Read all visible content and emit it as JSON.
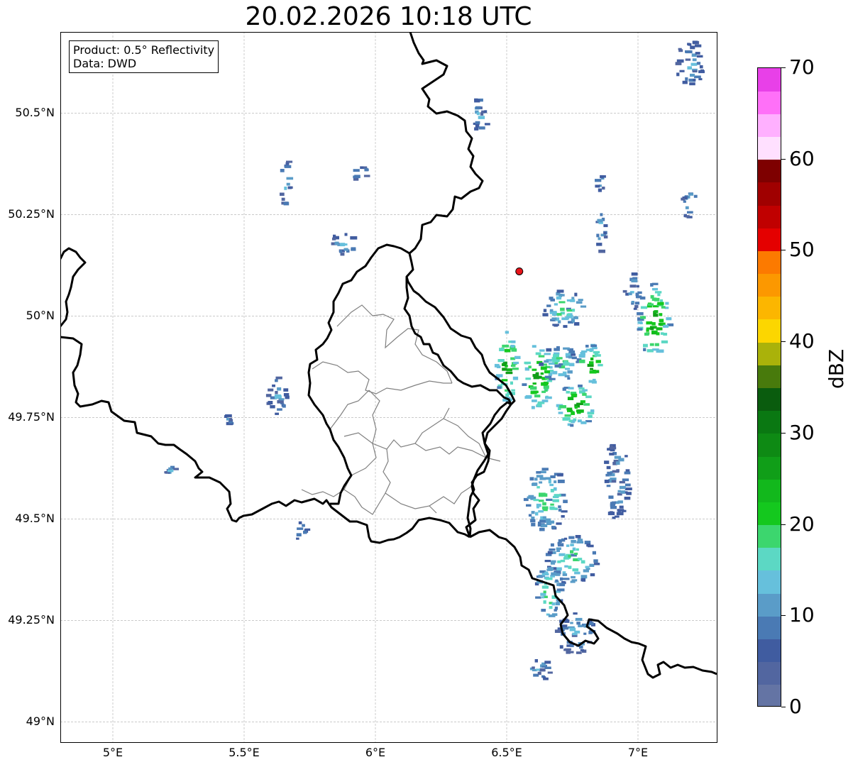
{
  "title": "20.02.2026 10:18 UTC",
  "infobox": {
    "line1": "Product: 0.5° Reflectivity",
    "line2": "Data: DWD"
  },
  "map": {
    "lon_range": [
      4.8,
      7.3
    ],
    "lat_range": [
      48.95,
      50.7
    ],
    "lat_ticks": [
      {
        "value": 50.5,
        "label": "50.5°N"
      },
      {
        "value": 50.25,
        "label": "50.25°N"
      },
      {
        "value": 50.0,
        "label": "50°N"
      },
      {
        "value": 49.75,
        "label": "49.75°N"
      },
      {
        "value": 49.5,
        "label": "49.5°N"
      },
      {
        "value": 49.25,
        "label": "49.25°N"
      },
      {
        "value": 49.0,
        "label": "49°N"
      }
    ],
    "lon_ticks": [
      {
        "value": 5.0,
        "label": "5°E"
      },
      {
        "value": 5.5,
        "label": "5.5°E"
      },
      {
        "value": 6.0,
        "label": "6°E"
      },
      {
        "value": 6.5,
        "label": "6.5°E"
      },
      {
        "value": 7.0,
        "label": "7°E"
      }
    ],
    "gridlines": true,
    "radar_site": {
      "lon": 6.548,
      "lat": 50.11,
      "color": "#e8141a"
    }
  },
  "colorbar": {
    "unit": "dBZ",
    "min": 0,
    "max": 70,
    "ticks": [
      {
        "value": 0,
        "label": "0"
      },
      {
        "value": 10,
        "label": "10"
      },
      {
        "value": 20,
        "label": "20"
      },
      {
        "value": 30,
        "label": "30"
      },
      {
        "value": 40,
        "label": "40"
      },
      {
        "value": 50,
        "label": "50"
      },
      {
        "value": 60,
        "label": "60"
      },
      {
        "value": 70,
        "label": "70"
      }
    ],
    "colors": [
      "#6474a4",
      "#5266a0",
      "#405ca0",
      "#4a7ab4",
      "#5a9cc8",
      "#66c0dc",
      "#5cd8c4",
      "#3cd66e",
      "#14c81e",
      "#12b81c",
      "#109e18",
      "#0e8a14",
      "#0a7812",
      "#0a5c0e",
      "#487a0c",
      "#aab20a",
      "#fcd600",
      "#fcb600",
      "#fc9800",
      "#fc7a00",
      "#e40000",
      "#c00000",
      "#a00000",
      "#7e0000",
      "#ffe0ff",
      "#ffb0ff",
      "#ff70f8",
      "#e840e8"
    ]
  },
  "echo_cells": [
    {
      "lon": 6.5,
      "lat": 49.88,
      "rx": 0.04,
      "ry": 0.1,
      "level": "high"
    },
    {
      "lon": 6.62,
      "lat": 49.85,
      "rx": 0.06,
      "ry": 0.08,
      "level": "high"
    },
    {
      "lon": 6.76,
      "lat": 49.78,
      "rx": 0.08,
      "ry": 0.05,
      "level": "high"
    },
    {
      "lon": 6.7,
      "lat": 49.88,
      "rx": 0.07,
      "ry": 0.05,
      "level": "mid"
    },
    {
      "lon": 6.82,
      "lat": 49.88,
      "rx": 0.05,
      "ry": 0.05,
      "level": "high"
    },
    {
      "lon": 6.72,
      "lat": 50.02,
      "rx": 0.08,
      "ry": 0.05,
      "level": "mid"
    },
    {
      "lon": 7.06,
      "lat": 49.99,
      "rx": 0.06,
      "ry": 0.09,
      "level": "high"
    },
    {
      "lon": 6.98,
      "lat": 50.06,
      "rx": 0.03,
      "ry": 0.05,
      "level": "low"
    },
    {
      "lon": 6.86,
      "lat": 50.22,
      "rx": 0.02,
      "ry": 0.06,
      "level": "low"
    },
    {
      "lon": 6.86,
      "lat": 50.33,
      "rx": 0.02,
      "ry": 0.02,
      "level": "low"
    },
    {
      "lon": 7.2,
      "lat": 50.62,
      "rx": 0.05,
      "ry": 0.06,
      "level": "low"
    },
    {
      "lon": 7.2,
      "lat": 50.28,
      "rx": 0.03,
      "ry": 0.04,
      "level": "low"
    },
    {
      "lon": 6.65,
      "lat": 49.55,
      "rx": 0.08,
      "ry": 0.08,
      "level": "mid"
    },
    {
      "lon": 6.92,
      "lat": 49.6,
      "rx": 0.05,
      "ry": 0.1,
      "level": "low"
    },
    {
      "lon": 6.75,
      "lat": 49.4,
      "rx": 0.1,
      "ry": 0.06,
      "level": "mid"
    },
    {
      "lon": 6.66,
      "lat": 49.32,
      "rx": 0.05,
      "ry": 0.08,
      "level": "mid"
    },
    {
      "lon": 6.76,
      "lat": 49.22,
      "rx": 0.08,
      "ry": 0.05,
      "level": "low"
    },
    {
      "lon": 6.62,
      "lat": 49.13,
      "rx": 0.05,
      "ry": 0.03,
      "level": "low"
    },
    {
      "lon": 5.66,
      "lat": 50.33,
      "rx": 0.02,
      "ry": 0.06,
      "level": "low"
    },
    {
      "lon": 5.95,
      "lat": 50.35,
      "rx": 0.04,
      "ry": 0.02,
      "level": "low"
    },
    {
      "lon": 5.63,
      "lat": 49.8,
      "rx": 0.04,
      "ry": 0.05,
      "level": "low"
    },
    {
      "lon": 5.45,
      "lat": 49.75,
      "rx": 0.02,
      "ry": 0.02,
      "level": "low"
    },
    {
      "lon": 5.72,
      "lat": 49.47,
      "rx": 0.02,
      "ry": 0.03,
      "level": "low"
    },
    {
      "lon": 5.22,
      "lat": 49.62,
      "rx": 0.02,
      "ry": 0.01,
      "level": "low"
    },
    {
      "lon": 5.88,
      "lat": 50.18,
      "rx": 0.05,
      "ry": 0.03,
      "level": "low"
    },
    {
      "lon": 6.4,
      "lat": 50.5,
      "rx": 0.03,
      "ry": 0.05,
      "level": "low"
    }
  ]
}
